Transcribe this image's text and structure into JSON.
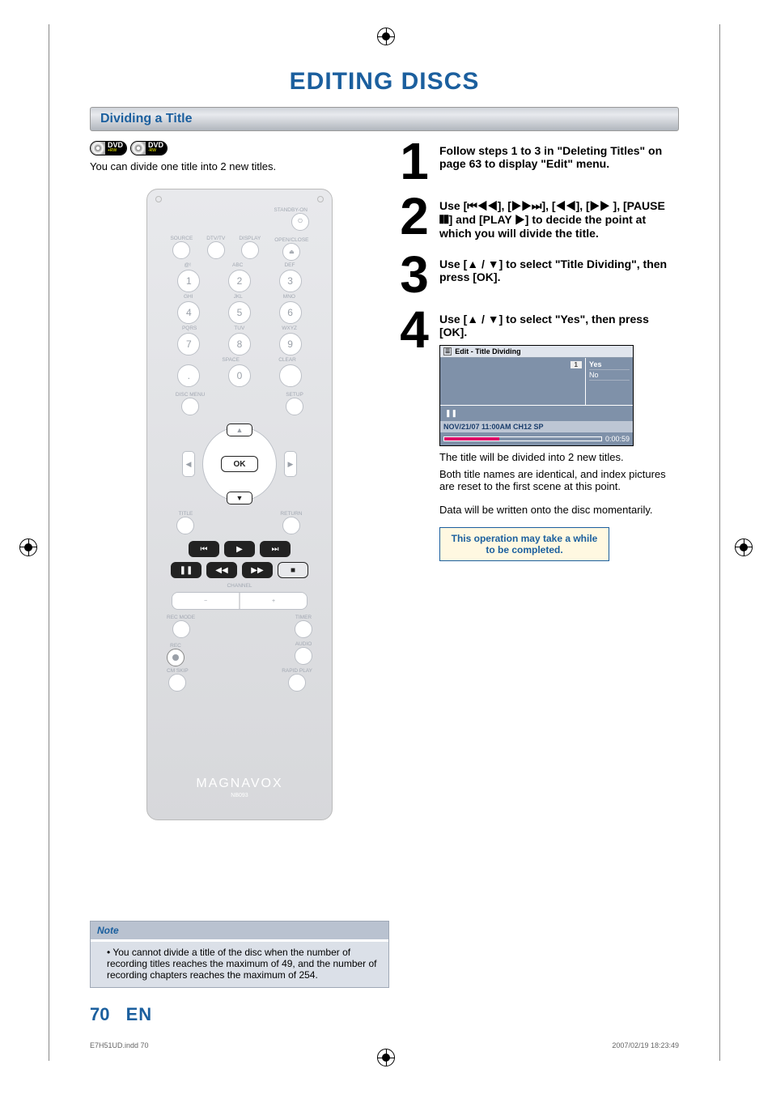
{
  "page_title": "EDITING DISCS",
  "section_header": "Dividing a Title",
  "disc_badges": [
    {
      "label": "DVD",
      "sub": "+RW"
    },
    {
      "label": "DVD",
      "sub": "-RW"
    }
  ],
  "intro_text": "You can divide one title into 2 new titles.",
  "remote": {
    "standby": "STANDBY-ON",
    "row1": [
      "SOURCE",
      "DTV/TV",
      "DISPLAY",
      "OPEN/CLOSE"
    ],
    "keypad_labels_top": [
      "@!",
      "ABC",
      "DEF"
    ],
    "keypad_labels_mid": [
      "GHI",
      "JKL",
      "MNO"
    ],
    "keypad_labels_bot": [
      "PQRS",
      "TUV",
      "WXYZ"
    ],
    "keypad_labels_last": [
      "",
      "SPACE",
      "CLEAR"
    ],
    "keypad": [
      "1",
      "2",
      "3",
      "4",
      "5",
      "6",
      "7",
      "8",
      "9",
      ".",
      "0",
      ""
    ],
    "disc_menu": "DISC MENU",
    "setup": "SETUP",
    "ok": "OK",
    "title": "TITLE",
    "return": "RETURN",
    "channel": "CHANNEL",
    "rec_mode": "REC MODE",
    "timer": "TIMER",
    "rec": "REC",
    "audio": "AUDIO",
    "cm_skip": "CM SKIP",
    "rapid": "RAPID PLAY",
    "brand": "MAGNAVOX",
    "model": "NB093"
  },
  "steps": [
    {
      "num": "1",
      "bold": "Follow steps 1 to 3 in \"Deleting Titles\" on page 63 to display \"Edit\" menu."
    },
    {
      "num": "2",
      "bold": "Use [⏮◀◀], [▶▶⏭], [◀◀], [▶▶ ], [PAUSE ❚❚] and [PLAY ▶] to decide the point at which you will divide the title."
    },
    {
      "num": "3",
      "bold": "Use [▲ / ▼] to select \"Title Dividing\", then press [OK]."
    },
    {
      "num": "4",
      "bold": "Use [▲ / ▼] to select \"Yes\", then press [OK].",
      "osd": {
        "title": "Edit - Title Dividing",
        "preview_num": "1",
        "opt_yes": "Yes",
        "opt_no": "No",
        "pause_icon": "❚❚",
        "info": "NOV/21/07 11:00AM CH12 SP",
        "time": "0:00:59"
      },
      "after1": "The title will be divided into 2 new titles.",
      "after2": "Both title names are identical, and index pictures are reset to the first scene at this point.",
      "after3": "Data will be written onto the disc momentarily.",
      "waitbox": "This operation may take a while to be completed."
    }
  ],
  "note": {
    "header": "Note",
    "item": "You cannot divide a title of the disc when the number of recording titles reaches the maximum of 49, and the number of recording chapters reaches the maximum of 254."
  },
  "page_number": "70",
  "page_lang": "EN",
  "footer_left": "E7H51UD.indd   70",
  "footer_right": "2007/02/19   18:23:49"
}
